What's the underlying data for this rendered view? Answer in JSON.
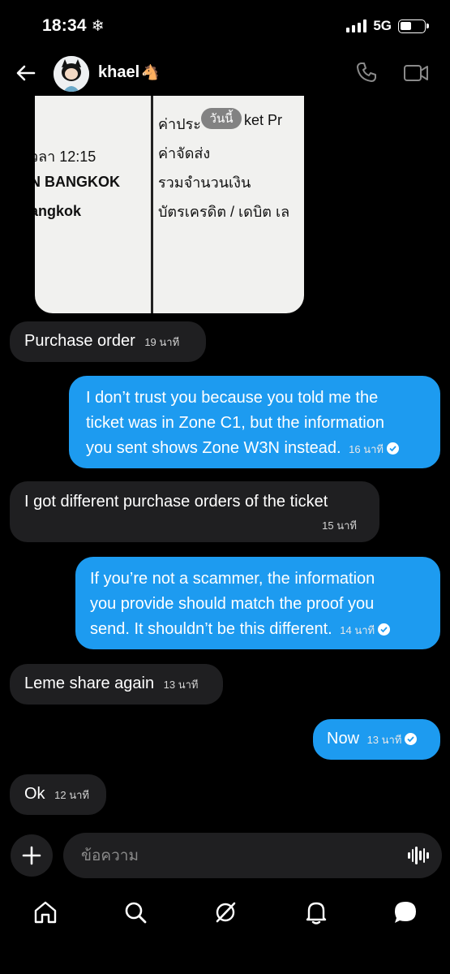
{
  "status": {
    "time": "18:34",
    "network": "5G"
  },
  "header": {
    "name": "khael"
  },
  "image_message": {
    "date_chip": "วันนี้",
    "left_lines": [
      "วลา 12:15",
      "N BANGKOK",
      "angkok"
    ],
    "right_lines": [
      "ค่าประ",
      "ket Pr",
      "ค่าจัดส่ง",
      "รวมจำนวนเงิน",
      "บัตรเครดิต / เดบิต เล"
    ]
  },
  "messages": [
    {
      "dir": "in",
      "text": "Purchase order",
      "time": "19 นาที"
    },
    {
      "dir": "out",
      "lines": [
        "I don’t trust you because you told me the",
        "ticket was in Zone C1, but the information",
        "you sent shows Zone W3N instead."
      ],
      "time": "16 นาที"
    },
    {
      "dir": "in",
      "text": "I got different purchase orders of the ticket",
      "time": "15 นาที"
    },
    {
      "dir": "out",
      "lines": [
        "If you’re not a scammer, the information",
        "you provide should match the proof you",
        "send. It shouldn’t be this different."
      ],
      "time": "14 นาที"
    },
    {
      "dir": "in",
      "text": "Leme share again",
      "time": "13 นาที"
    },
    {
      "dir": "out",
      "text": "Now",
      "time": "13 นาที"
    },
    {
      "dir": "in",
      "text": "Ok",
      "time": "12 นาที"
    }
  ],
  "composer": {
    "placeholder": "ข้อความ"
  },
  "nav": [
    "home-icon",
    "search-icon",
    "grok-icon",
    "notifications-icon",
    "messages-icon"
  ]
}
